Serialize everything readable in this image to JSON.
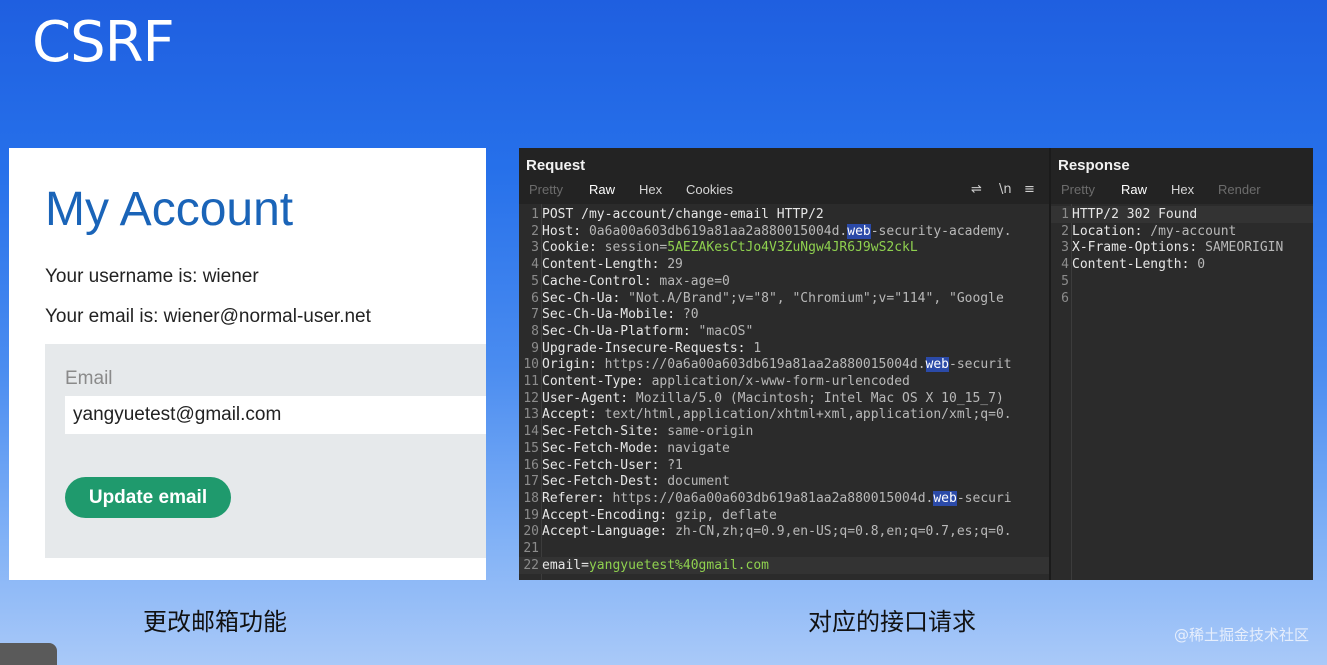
{
  "slide": {
    "title": "CSRF",
    "caption_left": "更改邮箱功能",
    "caption_right": "对应的接口请求",
    "watermark": "@稀土掘金技术社区"
  },
  "account": {
    "title": "My Account",
    "username_line": "Your username is: wiener",
    "email_line": "Your email is: wiener@normal-user.net",
    "email_label": "Email",
    "email_value": "yangyuetest@gmail.com",
    "update_button": "Update email"
  },
  "request": {
    "title": "Request",
    "tabs": [
      "Pretty",
      "Raw",
      "Hex",
      "Cookies"
    ],
    "active_tab": "Raw",
    "icons": [
      "list-icon",
      "newline-icon",
      "menu-icon"
    ],
    "lines": [
      {
        "n": "1",
        "k": "POST /my-account/change-email HTTP/2",
        "v": ""
      },
      {
        "n": "2",
        "k": "Host: ",
        "v": "0a6a00a603db619a81aa2a880015004d.",
        "w": "web",
        "rest": "-security-academy."
      },
      {
        "n": "3",
        "k": "Cookie: ",
        "v": "session=",
        "g": "5AEZAKesCtJo4V3ZuNgw4JR6J9wS2ckL"
      },
      {
        "n": "4",
        "k": "Content-Length: ",
        "v": "29"
      },
      {
        "n": "5",
        "k": "Cache-Control: ",
        "v": "max-age=0"
      },
      {
        "n": "6",
        "k": "Sec-Ch-Ua: ",
        "v": "\"Not.A/Brand\";v=\"8\", \"Chromium\";v=\"114\", \"Google"
      },
      {
        "n": "7",
        "k": "Sec-Ch-Ua-Mobile: ",
        "v": "?0"
      },
      {
        "n": "8",
        "k": "Sec-Ch-Ua-Platform: ",
        "v": "\"macOS\""
      },
      {
        "n": "9",
        "k": "Upgrade-Insecure-Requests: ",
        "v": "1"
      },
      {
        "n": "10",
        "k": "Origin: ",
        "v": "https://0a6a00a603db619a81aa2a880015004d.",
        "w": "web",
        "rest": "-securit"
      },
      {
        "n": "11",
        "k": "Content-Type: ",
        "v": "application/x-www-form-urlencoded"
      },
      {
        "n": "12",
        "k": "User-Agent: ",
        "v": "Mozilla/5.0 (Macintosh; Intel Mac OS X 10_15_7)"
      },
      {
        "n": "13",
        "k": "Accept: ",
        "v": "text/html,application/xhtml+xml,application/xml;q=0."
      },
      {
        "n": "14",
        "k": "Sec-Fetch-Site: ",
        "v": "same-origin"
      },
      {
        "n": "15",
        "k": "Sec-Fetch-Mode: ",
        "v": "navigate"
      },
      {
        "n": "16",
        "k": "Sec-Fetch-User: ",
        "v": "?1"
      },
      {
        "n": "17",
        "k": "Sec-Fetch-Dest: ",
        "v": "document"
      },
      {
        "n": "18",
        "k": "Referer: ",
        "v": "https://0a6a00a603db619a81aa2a880015004d.",
        "w": "web",
        "rest": "-securi"
      },
      {
        "n": "19",
        "k": "Accept-Encoding: ",
        "v": "gzip, deflate"
      },
      {
        "n": "20",
        "k": "Accept-Language: ",
        "v": "zh-CN,zh;q=0.9,en-US;q=0.8,en;q=0.7,es;q=0."
      },
      {
        "n": "21",
        "k": "",
        "v": ""
      },
      {
        "n": "22",
        "k": "email=",
        "v": "",
        "g": "yangyuetest%40gmail.com"
      }
    ]
  },
  "response": {
    "title": "Response",
    "tabs": [
      "Pretty",
      "Raw",
      "Hex",
      "Render"
    ],
    "active_tab": "Raw",
    "lines": [
      {
        "n": "1",
        "k": "HTTP/2 302 Found",
        "v": ""
      },
      {
        "n": "2",
        "k": "Location: ",
        "v": "/my-account"
      },
      {
        "n": "3",
        "k": "X-Frame-Options: ",
        "v": "SAMEORIGIN"
      },
      {
        "n": "4",
        "k": "Content-Length: ",
        "v": "0"
      },
      {
        "n": "5",
        "k": "",
        "v": ""
      },
      {
        "n": "6",
        "k": "",
        "v": ""
      }
    ]
  }
}
